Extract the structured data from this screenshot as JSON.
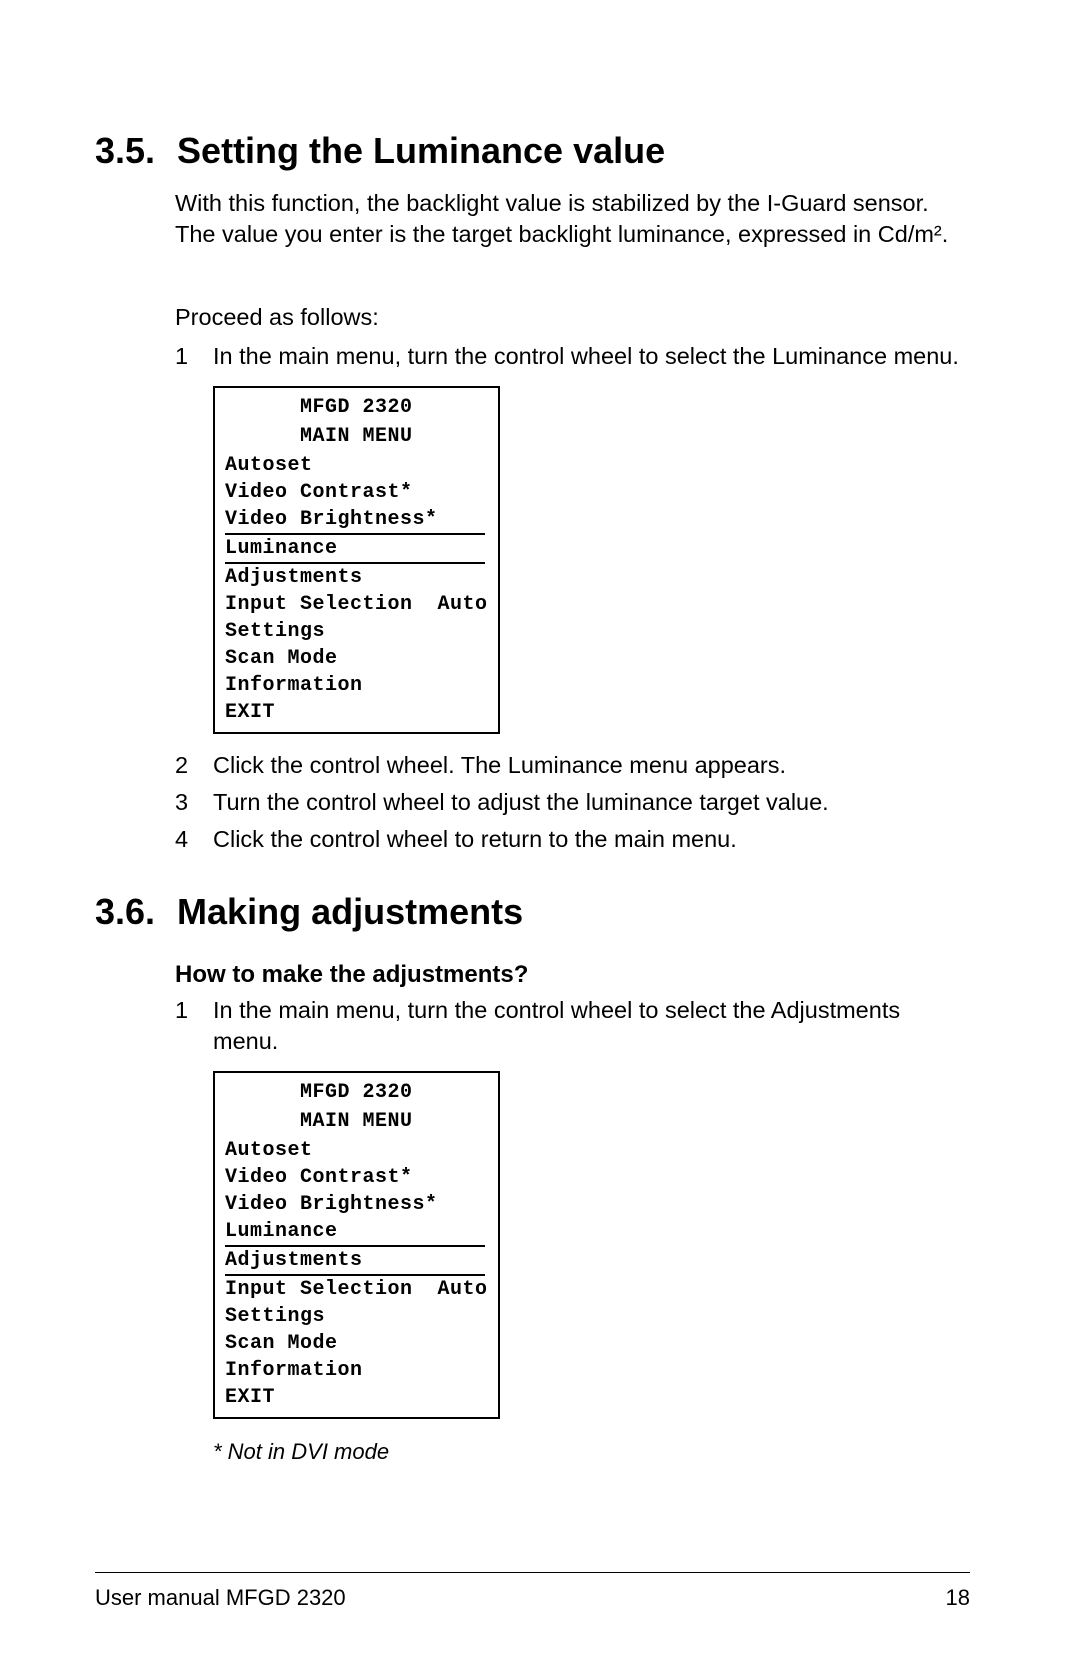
{
  "section35": {
    "number": "3.5.",
    "title": "Setting the Luminance value",
    "intro": "With this function, the backlight value is stabilized by the I-Guard sensor. The value you enter is the target backlight luminance, expressed in Cd/m².",
    "proceed": "Proceed as follows:",
    "step1_num": "1",
    "step1": "In the main menu, turn the control wheel to select the Luminance menu.",
    "step2_num": "2",
    "step2": "Click the control wheel. The Luminance menu appears.",
    "step3_num": "3",
    "step3": "Turn the control wheel to adjust the luminance target value.",
    "step4_num": "4",
    "step4": "Click the control wheel to return to the main menu."
  },
  "section36": {
    "number": "3.6.",
    "title": "Making adjustments",
    "sub": "How to make the adjustments?",
    "step1_num": "1",
    "step1": "In the main menu, turn the control wheel to select the Adjustments menu.",
    "footnote": "* Not in DVI mode"
  },
  "menu": {
    "product": "MFGD 2320",
    "title": "MAIN MENU",
    "autoset": "Autoset",
    "video_contrast": "Video Contrast*",
    "video_brightness": "Video Brightness*",
    "luminance": "Luminance",
    "adjustments": "Adjustments",
    "input_selection": "Input Selection  Auto",
    "settings": "Settings",
    "scan_mode": "Scan Mode",
    "information": "Information",
    "exit": "EXIT"
  },
  "footer": {
    "left": "User manual MFGD 2320",
    "right": "18"
  }
}
